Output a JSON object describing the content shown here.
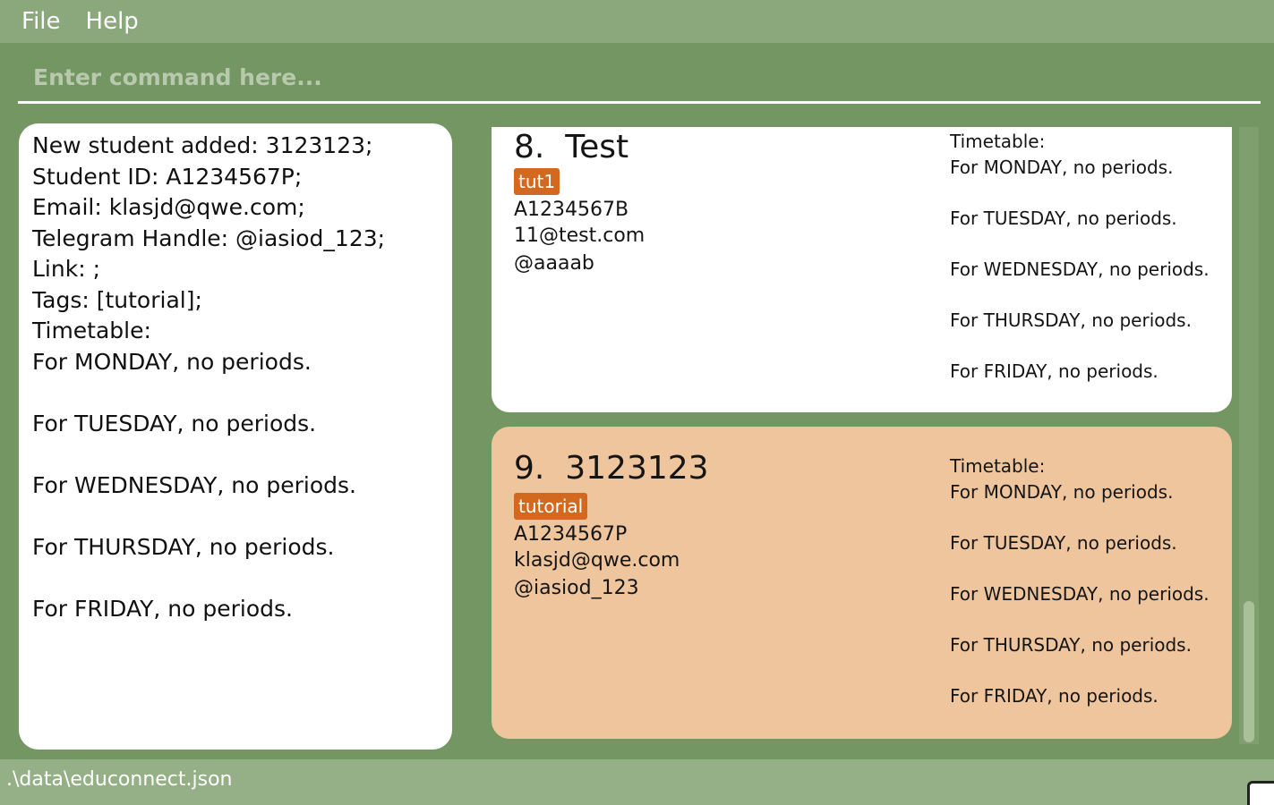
{
  "menu": {
    "file_label": "File",
    "help_label": "Help"
  },
  "command": {
    "placeholder": "Enter command here..."
  },
  "result": {
    "lines": [
      "New student added: 3123123;",
      "Student ID: A1234567P;",
      "Email: klasjd@qwe.com;",
      "Telegram Handle: @iasiod_123;",
      "Link: ;",
      "Tags: [tutorial];",
      "Timetable:",
      "For MONDAY, no periods.",
      "",
      "For TUESDAY, no periods.",
      "",
      "For WEDNESDAY, no periods.",
      "",
      "For THURSDAY, no periods.",
      "",
      "For FRIDAY, no periods."
    ]
  },
  "students": [
    {
      "index_name": "8.  Test",
      "tag": "tut1",
      "student_id": "A1234567B",
      "email": "11@test.com",
      "telegram": "@aaaab",
      "timetable_title": "Timetable:",
      "timetable": [
        "For MONDAY, no periods.",
        "For TUESDAY, no periods.",
        "For WEDNESDAY, no periods.",
        "For THURSDAY, no periods.",
        "For FRIDAY, no periods."
      ]
    },
    {
      "index_name": "9.  3123123",
      "tag": "tutorial",
      "student_id": "A1234567P",
      "email": "klasjd@qwe.com",
      "telegram": "@iasiod_123",
      "timetable_title": "Timetable:",
      "timetable": [
        "For MONDAY, no periods.",
        "For TUESDAY, no periods.",
        "For WEDNESDAY, no periods.",
        "For THURSDAY, no periods.",
        "For FRIDAY, no periods."
      ]
    }
  ],
  "status": {
    "file_path": ".\\data\\educonnect.json"
  },
  "colors": {
    "background": "#739663",
    "menubar": "#8ba77c",
    "selected_card": "#eec59d",
    "tag": "#d2691e"
  }
}
